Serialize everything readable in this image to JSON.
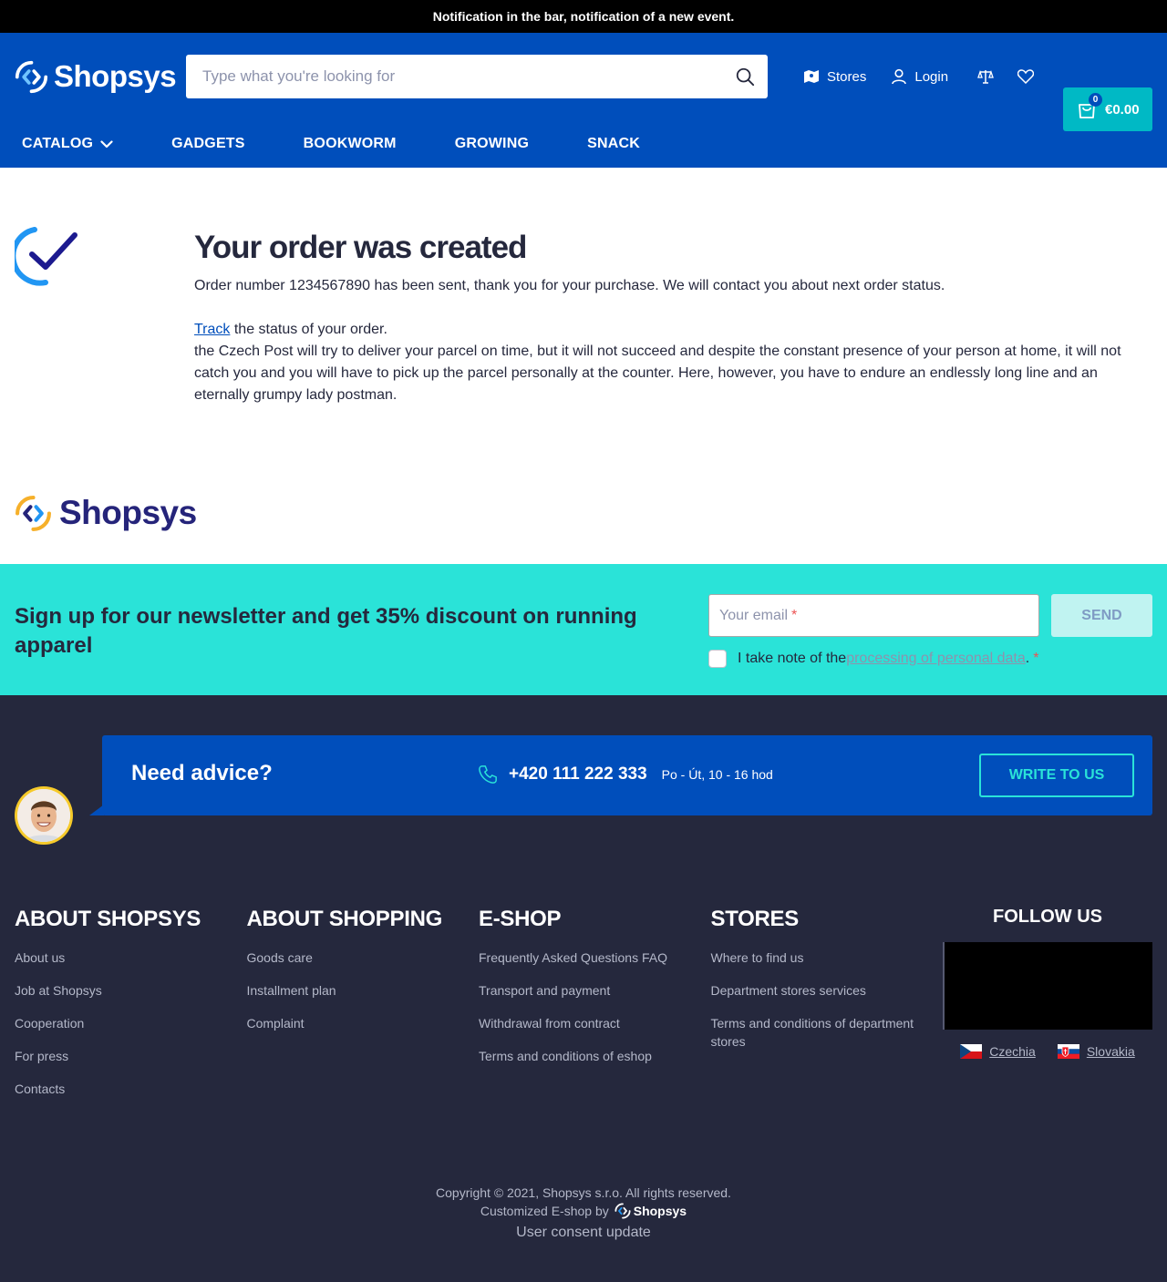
{
  "notification": "Notification in the bar, notification of a new event.",
  "header": {
    "logo": "Shopsys",
    "search_placeholder": "Type what you're looking for",
    "stores_label": "Stores",
    "login_label": "Login",
    "cart_count": "0",
    "cart_price": "€0.00"
  },
  "nav": {
    "items": [
      "CATALOG",
      "GADGETS",
      "BOOKWORM",
      "GROWING",
      "SNACK"
    ]
  },
  "main": {
    "title": "Your order was created",
    "order_text": "Order number 1234567890 has been sent, thank you for your purchase. We will contact you about next order status.",
    "track_link": "Track",
    "track_text": " the status of your order.",
    "delivery_text": "the Czech Post will try to deliver your parcel on time, but it will not succeed and despite the constant presence of your person at home, it will not catch you and you will have to pick up the parcel personally at the counter. Here, however, you have to endure an endlessly long line and an eternally grumpy lady postman.",
    "logo": "Shopsys"
  },
  "newsletter": {
    "title": "Sign up for our newsletter and get 35% discount on running apparel",
    "email_placeholder": "Your email",
    "required_mark": "*",
    "send_label": "SEND",
    "consent_prefix": "I take note of the ",
    "consent_link": "processing of personal data",
    "consent_suffix": "."
  },
  "advice": {
    "title": "Need advice?",
    "phone": "+420 111 222 333",
    "hours": "Po - Út, 10 - 16 hod",
    "button": "WRITE TO US"
  },
  "footer": {
    "columns": [
      {
        "title": "ABOUT SHOPSYS",
        "links": [
          "About us",
          "Job at Shopsys",
          "Cooperation",
          "For press",
          "Contacts"
        ]
      },
      {
        "title": "ABOUT SHOPPING",
        "links": [
          "Goods care",
          "Installment plan",
          "Complaint"
        ]
      },
      {
        "title": "E-SHOP",
        "links": [
          "Frequently Asked Questions FAQ",
          "Transport and payment",
          "Withdrawal from contract",
          "Terms and conditions of eshop"
        ]
      },
      {
        "title": "STORES",
        "links": [
          "Where to find us",
          "Department stores services",
          "Terms and conditions of department stores"
        ]
      }
    ],
    "follow_title": "FOLLOW US",
    "languages": [
      "Czechia",
      "Slovakia"
    ],
    "copyright": "Copyright © 2021, Shopsys s.r.o. All rights reserved.",
    "customized": "Customized E-shop by",
    "customized_brand": "Shopsys",
    "consent_update": "User consent update"
  },
  "colors": {
    "primary": "#004ebb",
    "accent": "#00b9c5",
    "newsletter_bg": "#2ae3d8",
    "footer_bg": "#25283d"
  }
}
